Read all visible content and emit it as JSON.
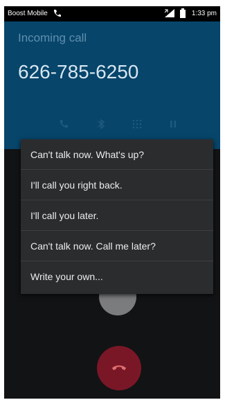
{
  "status_bar": {
    "carrier": "Boost Mobile",
    "time": "1:33 pm"
  },
  "call": {
    "title": "Incoming call",
    "number": "626-785-6250"
  },
  "action_icons": [
    "phone-icon",
    "bluetooth-icon",
    "dialpad-icon",
    "pause-icon"
  ],
  "quick_replies": [
    "Can't talk now. What's up?",
    "I'll call you right back.",
    "I'll call you later.",
    "Can't talk now. Call me later?",
    "Write your own..."
  ],
  "colors": {
    "header_bg": "#07456a",
    "menu_bg": "#2b2c2e",
    "decline": "#7a1727"
  }
}
